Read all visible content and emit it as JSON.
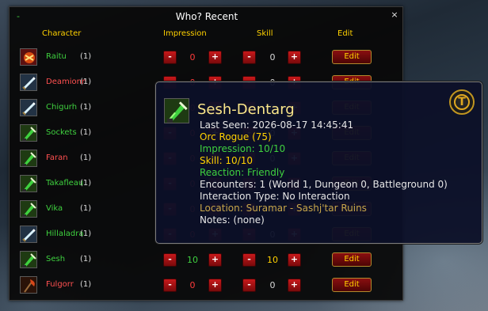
{
  "window": {
    "title": "Who? Recent",
    "dash": "-",
    "close": "×"
  },
  "columns": {
    "character": "Character",
    "impression": "Impression",
    "skill": "Skill",
    "edit": "Edit"
  },
  "button_labels": {
    "minus": "-",
    "plus": "+",
    "edit": "Edit"
  },
  "rows": [
    {
      "name": "Raitu",
      "count": "(1)",
      "name_color": "green",
      "icon": "rune-icon",
      "impression": "0",
      "skill": "0"
    },
    {
      "name": "Deamionn",
      "count": "(1)",
      "name_color": "red",
      "icon": "sword-icon",
      "impression": "0",
      "skill": "0"
    },
    {
      "name": "Chigurh",
      "count": "(1)",
      "name_color": "green",
      "icon": "sword-icon",
      "impression": "0",
      "skill": "0"
    },
    {
      "name": "Sockets",
      "count": "(1)",
      "name_color": "green",
      "icon": "dagger-icon",
      "impression": "0",
      "skill": "0"
    },
    {
      "name": "Faran",
      "count": "(1)",
      "name_color": "red",
      "icon": "dagger-icon",
      "impression": "0",
      "skill": "0"
    },
    {
      "name": "Takafleau",
      "count": "(1)",
      "name_color": "green",
      "icon": "dagger-icon",
      "impression": "0",
      "skill": "0"
    },
    {
      "name": "Vika",
      "count": "(1)",
      "name_color": "green",
      "icon": "dagger-icon",
      "impression": "0",
      "skill": "0"
    },
    {
      "name": "Hillaladra",
      "count": "(1)",
      "name_color": "green",
      "icon": "sword-icon",
      "impression": "0",
      "skill": "0"
    },
    {
      "name": "Sesh",
      "count": "(1)",
      "name_color": "green",
      "icon": "dagger-icon",
      "impression": "10",
      "skill": "10"
    },
    {
      "name": "Fulgorr",
      "count": "(1)",
      "name_color": "red",
      "icon": "axe-icon",
      "impression": "0",
      "skill": "0"
    }
  ],
  "tooltip": {
    "title": "Sesh-Dentarg",
    "badge": "T",
    "last_seen": "Last Seen: 2026-08-17 14:45:41",
    "class": "Orc Rogue (75)",
    "impression": "Impression: 10/10",
    "skill": "Skill: 10/10",
    "reaction": "Reaction: Friendly",
    "encounters": "Encounters: 1 (World 1, Dungeon 0, Battleground 0)",
    "interaction": "Interaction Type: No Interaction",
    "location": "Location: Suramar - Sashj'tar Ruins",
    "notes": "Notes: (none)"
  },
  "colors": {
    "name_green": "#3fd13f",
    "name_red": "#ff5050",
    "header_gold": "#ffd100",
    "button_red": "#c8191b",
    "tooltip_bg": "#0c1028"
  }
}
